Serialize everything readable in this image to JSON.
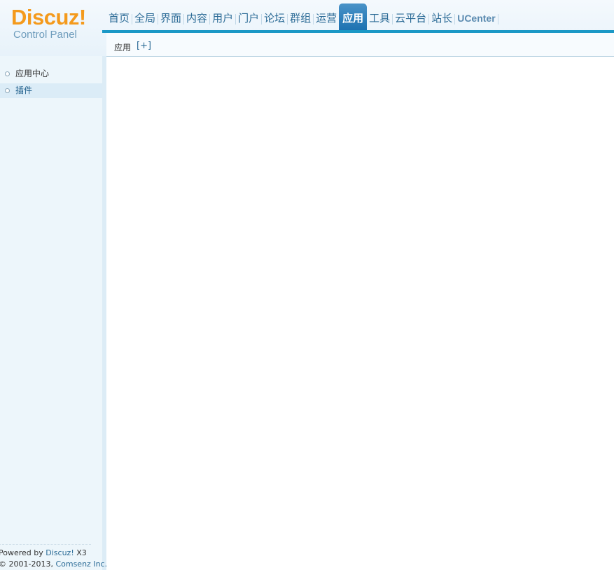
{
  "logo": {
    "main": "Discuz!",
    "sub": "Control Panel"
  },
  "topnav": {
    "items": [
      {
        "label": "首页"
      },
      {
        "label": "全局"
      },
      {
        "label": "界面"
      },
      {
        "label": "内容"
      },
      {
        "label": "用户"
      },
      {
        "label": "门户"
      },
      {
        "label": "论坛"
      },
      {
        "label": "群组"
      },
      {
        "label": "运营"
      },
      {
        "label": "应用",
        "active": true
      },
      {
        "label": "工具"
      },
      {
        "label": "云平台"
      },
      {
        "label": "站长"
      },
      {
        "label": "UCenter"
      }
    ]
  },
  "breadcrumb": {
    "current": "应用",
    "add": "[+]"
  },
  "sidebar": {
    "items": [
      {
        "label": "应用中心"
      },
      {
        "label": "插件",
        "active": true
      }
    ]
  },
  "footer": {
    "powered_prefix": "Powered by ",
    "powered_link": "Discuz!",
    "powered_suffix": " X3",
    "copy_prefix": "© 2001-2013, ",
    "copy_link": "Comsenz Inc."
  },
  "colors": {
    "accent": "#1b98c6",
    "logo": "#f49a1c",
    "active_tab": "#1b70b0",
    "link": "#2b6b96"
  }
}
